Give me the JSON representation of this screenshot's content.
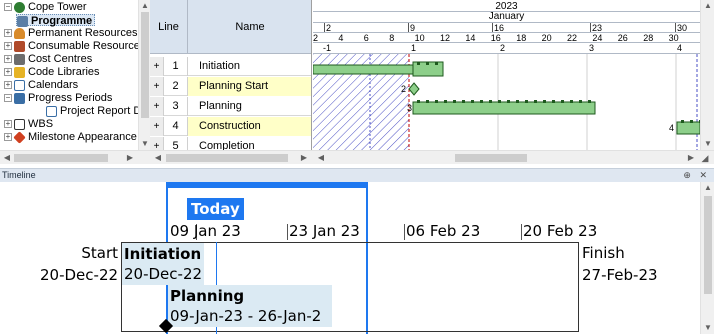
{
  "tree": {
    "items": [
      {
        "label": "Cope Tower",
        "icon": "globe-icon",
        "color": "#2e7d32",
        "expander": "−",
        "indent": 0,
        "bold": false,
        "selected": false
      },
      {
        "label": "Programme",
        "icon": "document-icon",
        "color": "#5b7fa6",
        "expander": "",
        "indent": 1,
        "bold": true,
        "selected": true
      },
      {
        "label": "Permanent Resources",
        "icon": "person-icon",
        "color": "#d98b2b",
        "expander": "+",
        "indent": 0,
        "bold": false,
        "selected": false
      },
      {
        "label": "Consumable Resources",
        "icon": "boxes-icon",
        "color": "#b04a2a",
        "expander": "+",
        "indent": 0,
        "bold": false,
        "selected": false
      },
      {
        "label": "Cost Centres",
        "icon": "bank-icon",
        "color": "#6d6d6d",
        "expander": "+",
        "indent": 0,
        "bold": false,
        "selected": false
      },
      {
        "label": "Code Libraries",
        "icon": "folder-icon",
        "color": "#e6b325",
        "expander": "+",
        "indent": 0,
        "bold": false,
        "selected": false
      },
      {
        "label": "Calendars",
        "icon": "calendar-icon",
        "color": "#3a6ea5",
        "expander": "+",
        "indent": 0,
        "bold": false,
        "selected": false
      },
      {
        "label": "Progress Periods",
        "icon": "progress-icon",
        "color": "#3a6ea5",
        "expander": "−",
        "indent": 0,
        "bold": false,
        "selected": false
      },
      {
        "label": "Project Report Date",
        "icon": "report-icon",
        "color": "#3a6ea5",
        "expander": "",
        "indent": 1,
        "bold": false,
        "selected": false
      },
      {
        "label": "WBS",
        "icon": "wbs-icon",
        "color": "#333333",
        "expander": "+",
        "indent": 0,
        "bold": false,
        "selected": false
      },
      {
        "label": "Milestone Appearance",
        "icon": "milestone-icon",
        "color": "#d04020",
        "expander": "+",
        "indent": 0,
        "bold": false,
        "selected": false
      }
    ]
  },
  "grid": {
    "headers": {
      "line": "Line",
      "name": "Name"
    },
    "rows": [
      {
        "line": "1",
        "name": "Initiation",
        "highlight": false
      },
      {
        "line": "2",
        "name": "Planning Start",
        "highlight": true
      },
      {
        "line": "3",
        "name": "Planning",
        "highlight": false
      },
      {
        "line": "4",
        "name": "Construction",
        "highlight": true
      },
      {
        "line": "5",
        "name": "Completion",
        "highlight": false
      }
    ]
  },
  "gantt": {
    "year": "2023",
    "month": "January",
    "day_ticks": [
      "2",
      "4",
      "6",
      "8",
      "10",
      "12",
      "14",
      "16",
      "18",
      "20",
      "22",
      "24",
      "26",
      "28",
      "30"
    ],
    "week_ticks": [
      "2",
      "9",
      "16",
      "23",
      "30"
    ],
    "period_ticks": [
      "-1",
      "1",
      "2",
      "3",
      "4"
    ],
    "milestone_label": "2",
    "row3_label": "3",
    "row4_label": "4",
    "bar_color": "#8dcf8a",
    "hatch_color": "#4a4fc4"
  },
  "timeline": {
    "title": "Timeline",
    "controls": "⊕ ✕",
    "today_label": "Today",
    "date_marks": [
      "09 Jan 23",
      "23 Jan 23",
      "06 Feb 23",
      "20 Feb 23"
    ],
    "start_label": "Start",
    "start_date": "20-Dec-22",
    "finish_label": "Finish",
    "finish_date": "27-Feb-23",
    "tasks": [
      {
        "name": "Initiation",
        "dates": "20-Dec-22"
      },
      {
        "name": "Planning",
        "dates": "09-Jan-23 - 26-Jan-2"
      }
    ],
    "today_color": "#1e78f0"
  }
}
